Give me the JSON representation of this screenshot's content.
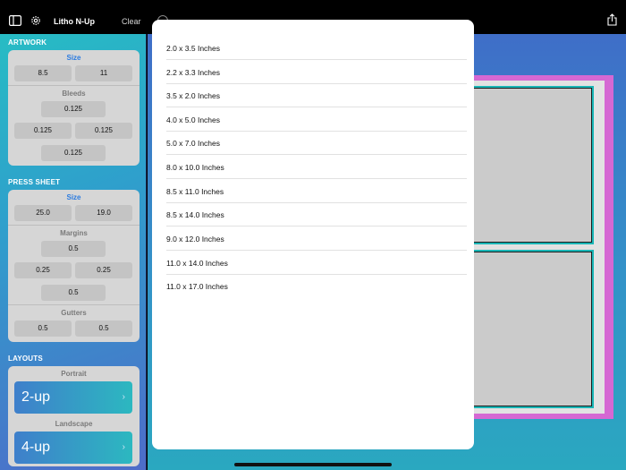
{
  "app": {
    "title": "Litho N-Up",
    "clear_label": "Clear",
    "accent_color": "#2b7be0"
  },
  "icons": [
    "sidebar-toggle-icon",
    "gear-icon",
    "share-icon",
    "circle-icon"
  ],
  "artwork": {
    "section_title": "ARTWORK",
    "size_label": "Size",
    "width": "8.5",
    "height": "11",
    "bleeds_label": "Bleeds",
    "bleed_top": "0.125",
    "bleed_left": "0.125",
    "bleed_right": "0.125",
    "bleed_bottom": "0.125"
  },
  "press_sheet": {
    "section_title": "PRESS SHEET",
    "size_label": "Size",
    "width": "25.0",
    "height": "19.0",
    "margins_label": "Margins",
    "margin_top": "0.5",
    "margin_left": "0.25",
    "margin_right": "0.25",
    "margin_bottom": "0.5",
    "gutters_label": "Gutters",
    "gutter_h": "0.5",
    "gutter_v": "0.5"
  },
  "layouts": {
    "section_title": "LAYOUTS",
    "portrait_label": "Portrait",
    "portrait_value": "2-up",
    "landscape_label": "Landscape",
    "landscape_value": "4-up"
  },
  "size_menu": {
    "options": [
      "2.0 x 3.5 Inches",
      "2.2 x 3.3 Inches",
      "3.5 x 2.0 Inches",
      "4.0 x 5.0 Inches",
      "5.0 x 7.0 Inches",
      "8.0 x 10.0 Inches",
      "8.5 x 11.0 Inches",
      "8.5 x 14.0 Inches",
      "9.0 x 12.0 Inches",
      "11.0 x 14.0 Inches",
      "11.0 x 17.0 Inches"
    ]
  }
}
